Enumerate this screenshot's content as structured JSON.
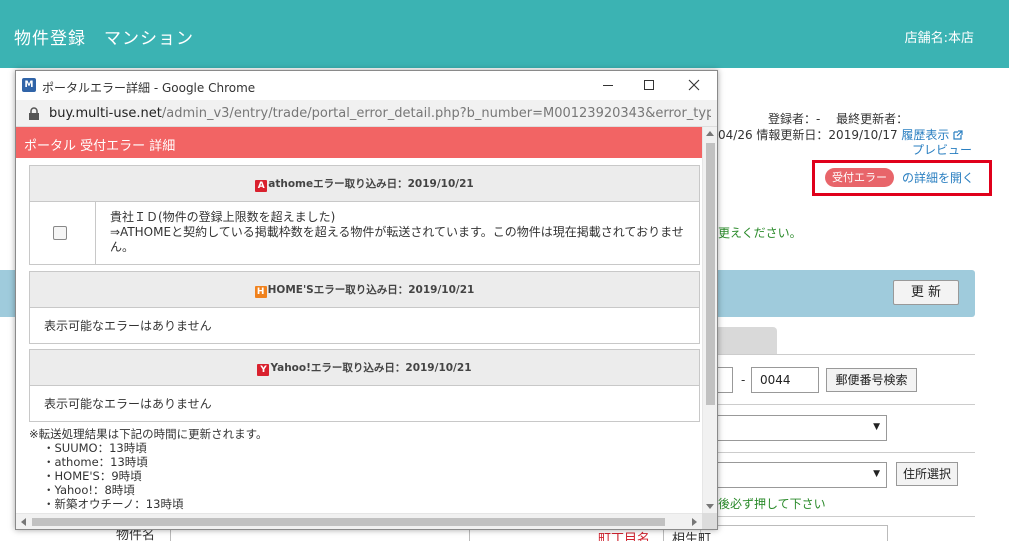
{
  "page": {
    "title": "物件登録　マンション",
    "store": "店舗名:本店",
    "meta_line1": "登録者：-　 最終更新者：",
    "meta_date_left": "04/26",
    "meta_info_update": "情報更新日：2019/10/17",
    "history_link": "履歴表示",
    "preview_link": "プレビュー",
    "error_pill": "受付エラー",
    "error_link": "の詳細を開く",
    "notice_fragment": "更えください。",
    "update_button": "更 新",
    "zip_value": "0044",
    "zip_dash": "-",
    "zip_search_button": "郵便番号検索",
    "address_select_button": "住所選択",
    "address_hint": "沢後必ず押して下さい",
    "label_bukken": "物件名",
    "label_chome": "町丁目名",
    "chome_value": "相生町"
  },
  "popup": {
    "window_title": "ポータルエラー詳細 - Google Chrome",
    "logo_letter": "M",
    "url_host": "buy.multi-use.net",
    "url_path": "/admin_v3/entry/trade/portal_error_detail.php?b_number=M00123920343&error_typ...",
    "header": "ポータル 受付エラー 詳細",
    "sections": [
      {
        "badge": "A",
        "title": "athomeエラー取り込み日：2019/10/21",
        "error_line1": "貴社ＩＤ(物件の登録上限数を超えました)",
        "error_line2": "⇒ATHOMEと契約している掲載枠数を超える物件が転送されています。この物件は現在掲載されておりません。"
      },
      {
        "badge": "H",
        "title": "HOME'Sエラー取り込み日：2019/10/21",
        "message": "表示可能なエラーはありません"
      },
      {
        "badge": "Y",
        "title": "Yahoo!エラー取り込み日：2019/10/21",
        "message": "表示可能なエラーはありません"
      }
    ],
    "note_title": "※転送処理結果は下記の時間に更新されます。",
    "note_items": [
      "・SUUMO：13時頃",
      "・athome：13時頃",
      "・HOME'S：9時頃",
      "・Yahoo!：8時頃",
      "・新築オウチーノ：13時頃"
    ]
  },
  "colors": {
    "topbar": "#3bb3b3",
    "popup_header": "#f26464",
    "highlight_border": "#e0001b",
    "link": "#2a7fc1"
  }
}
